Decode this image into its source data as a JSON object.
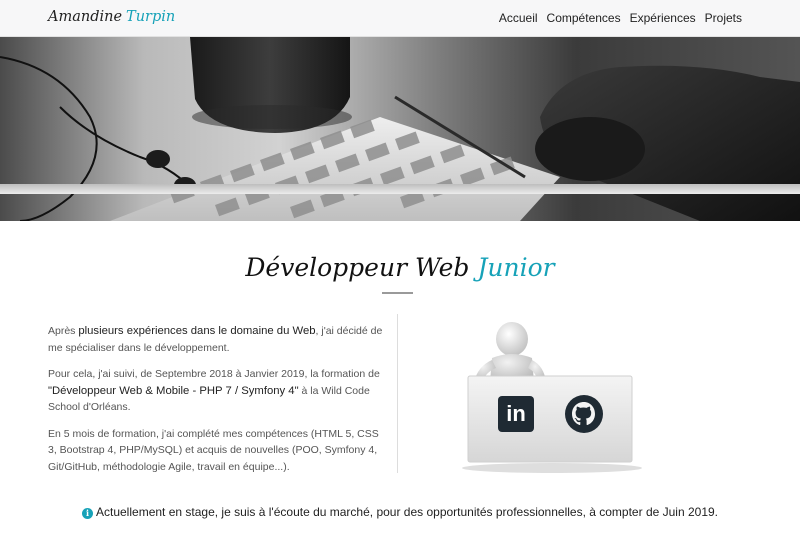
{
  "navbar": {
    "brand_first": "Amandine",
    "brand_last": "Turpin",
    "links": [
      "Accueil",
      "Compétences",
      "Expériences",
      "Projets"
    ]
  },
  "hero": {
    "alt": "keyboard-mouse-desk-photo"
  },
  "heading": {
    "main": "Développeur Web",
    "accent": "Junior"
  },
  "intro": {
    "p1_pre": "Après ",
    "p1_strong": "plusieurs expériences dans le domaine du Web",
    "p1_post": ", j'ai décidé de me spécialiser dans le développement.",
    "p2_pre": "Pour cela, j'ai suivi, de Septembre 2018 à Janvier 2019, la formation de ",
    "p2_strong": "\"Développeur Web & Mobile - PHP 7 / Symfony 4\"",
    "p2_post": " à la Wild Code School d'Orléans.",
    "p3": "En 5 mois de formation, j'ai complété mes compétences (HTML 5, CSS 3, Bootstrap 4, PHP/MySQL) et acquis de nouvelles (POO, Symfony 4, Git/GitHub, méthodologie Agile, travail en équipe...)."
  },
  "social": {
    "linkedin_icon": "linkedin-icon",
    "github_icon": "github-icon",
    "linkedin_label": "in"
  },
  "note": {
    "icon": "info-icon",
    "text": "Actuellement en stage, je suis à l'écoute du marché, pour des opportunités professionnelles, à compter de Juin 2019."
  },
  "colors": {
    "accent": "#17a2b8",
    "text": "#333333",
    "navbar_bg": "#f7f7f8"
  }
}
